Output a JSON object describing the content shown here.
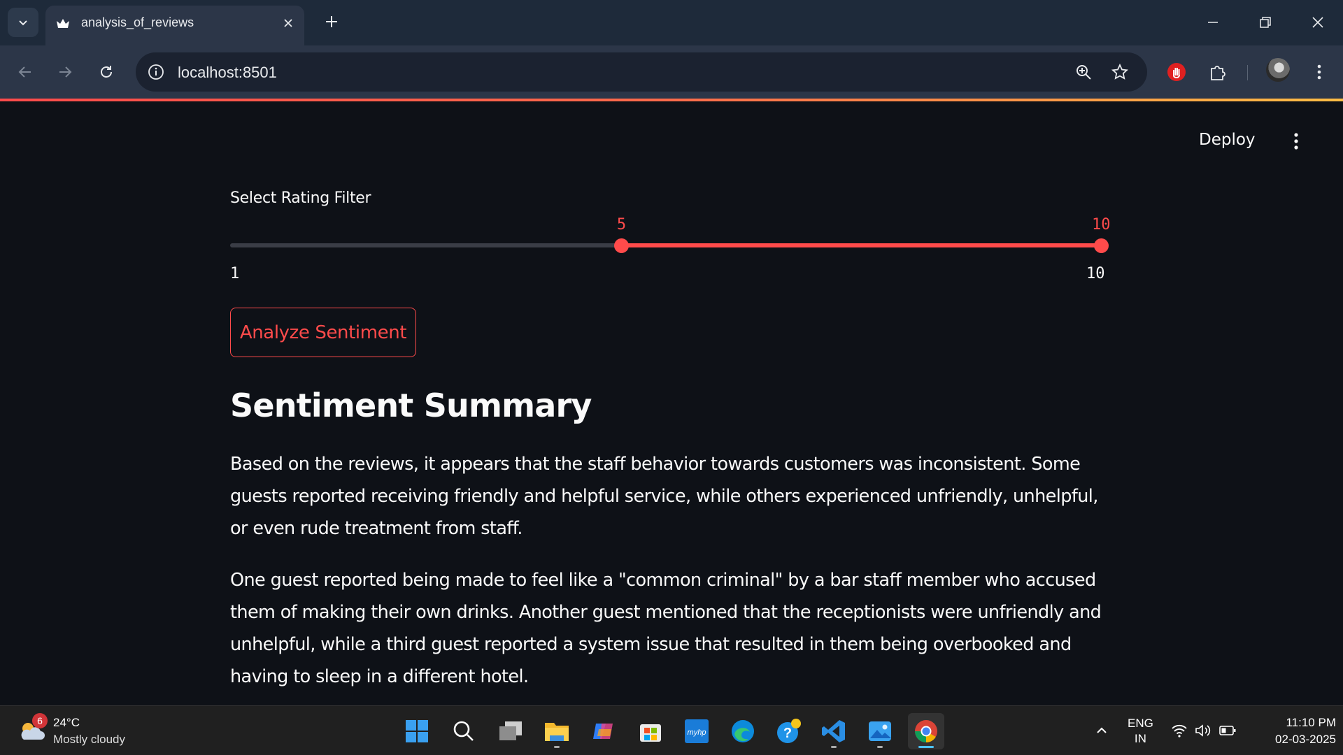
{
  "browser": {
    "tab_title": "analysis_of_reviews",
    "url": "localhost:8501"
  },
  "app": {
    "deploy_label": "Deploy",
    "slider": {
      "label": "Select Rating Filter",
      "min": 1,
      "max": 10,
      "low": 5,
      "high": 10,
      "min_label": "1",
      "max_label": "10",
      "low_label": "5",
      "high_label": "10"
    },
    "analyze_button": "Analyze Sentiment",
    "summary_title": "Sentiment Summary",
    "paragraphs": [
      "Based on the reviews, it appears that the staff behavior towards customers was inconsistent. Some guests reported receiving friendly and helpful service, while others experienced unfriendly, unhelpful, or even rude treatment from staff.",
      "One guest reported being made to feel like a \"common criminal\" by a bar staff member who accused them of making their own drinks. Another guest mentioned that the receptionists were unfriendly and unhelpful, while a third guest reported a system issue that resulted in them being overbooked and having to sleep in a different hotel."
    ],
    "accent_color": "#ff4b4b"
  },
  "taskbar": {
    "weather_badge": "6",
    "temperature": "24°C",
    "weather": "Mostly cloudy",
    "lang_line1": "ENG",
    "lang_line2": "IN",
    "time": "11:10 PM",
    "date": "02-03-2025",
    "apps": [
      "start-icon",
      "search-icon",
      "task-view-icon",
      "file-explorer-icon",
      "copilot-icon",
      "store-icon",
      "myhp-icon",
      "edge-icon",
      "help-icon",
      "vscode-icon",
      "photos-icon",
      "chrome-icon"
    ]
  }
}
